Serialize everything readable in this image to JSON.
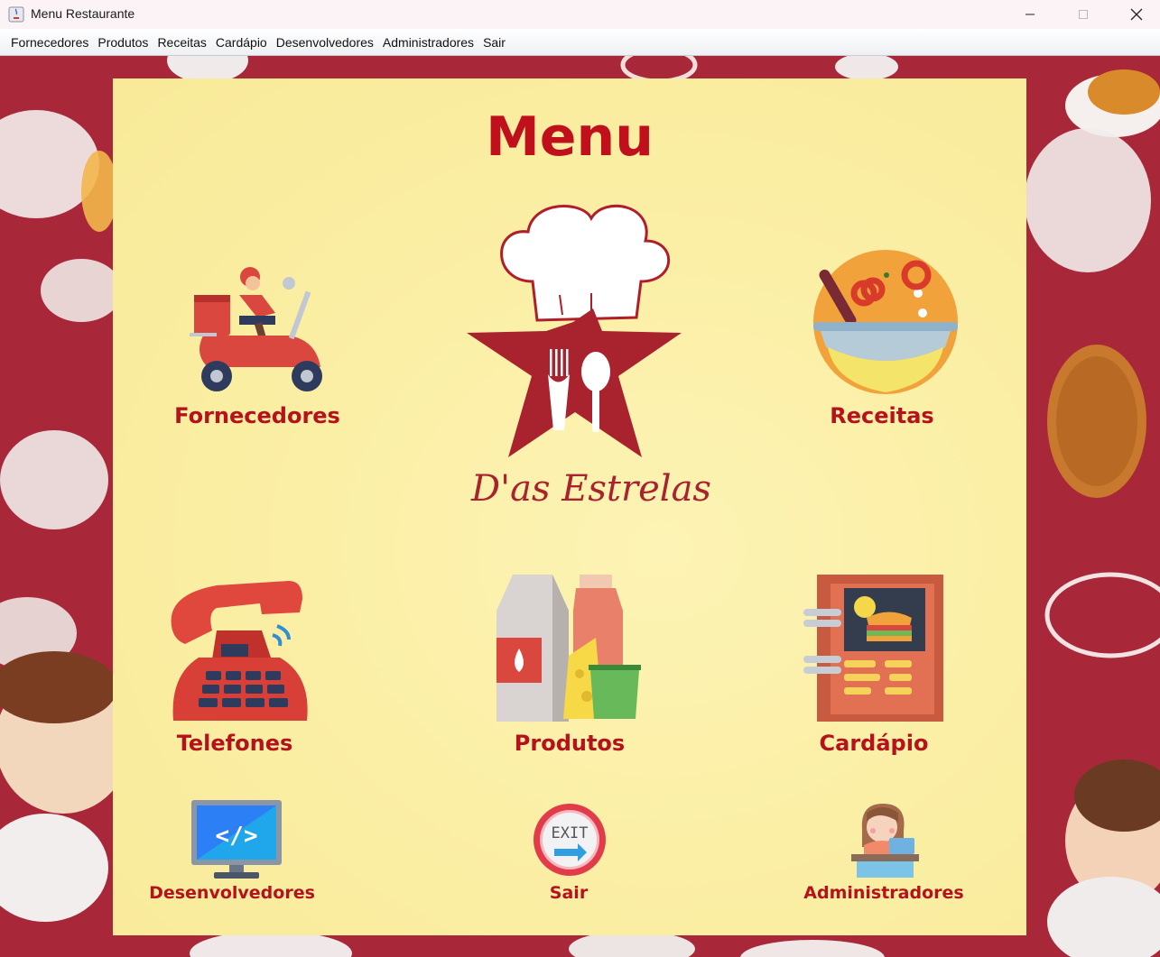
{
  "window": {
    "title": "Menu Restaurante"
  },
  "menubar": {
    "items": [
      "Fornecedores",
      "Produtos",
      "Receitas",
      "Cardápio",
      "Desenvolvedores",
      "Administradores",
      "Sair"
    ]
  },
  "main": {
    "title": "Menu",
    "logo_text": "D'as Estrelas",
    "tiles": {
      "fornecedores": "Fornecedores",
      "receitas": "Receitas",
      "telefones": "Telefones",
      "produtos": "Produtos",
      "cardapio": "Cardápio",
      "desenvolvedores": "Desenvolvedores",
      "sair": "Sair",
      "administradores": "Administradores"
    },
    "exit_sign": "EXIT"
  },
  "colors": {
    "background": "#a8283a",
    "panel": "#fbefa6",
    "accent": "#c0101c"
  }
}
